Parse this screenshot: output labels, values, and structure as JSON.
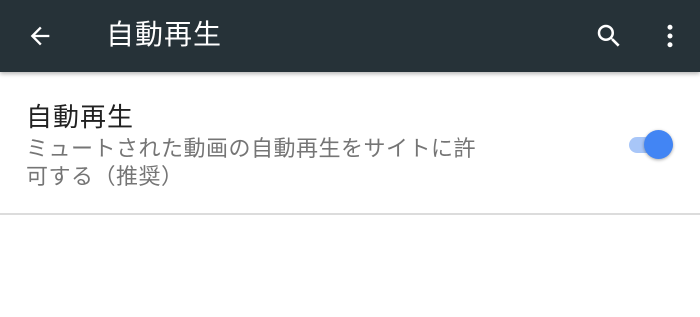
{
  "appbar": {
    "title": "自動再生",
    "back_icon": "arrow-back-icon",
    "search_icon": "search-icon",
    "more_icon": "more-vert-icon"
  },
  "setting": {
    "title": "自動再生",
    "summary": "ミュートされた動画の自動再生をサイトに許可する（推奨）",
    "toggle_on": true
  },
  "colors": {
    "appbar_bg": "#263238",
    "accent": "#4285f4",
    "track": "#a8c6f8"
  }
}
